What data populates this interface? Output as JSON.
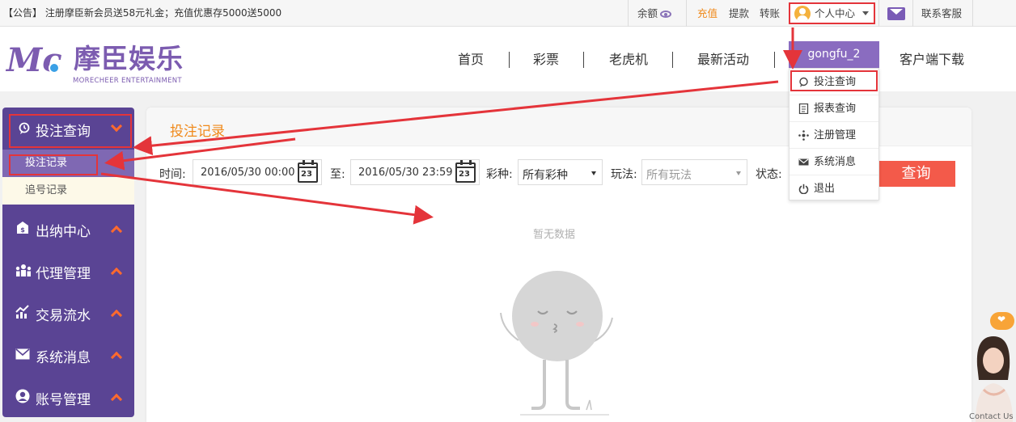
{
  "topbar": {
    "notice": "【公告】 注册摩臣新会员送58元礼金；充值优惠存5000送5000",
    "balance_label": "余额",
    "recharge": "充值",
    "withdraw": "提款",
    "transfer": "转账",
    "personal_center": "个人中心",
    "customer_service": "联系客服"
  },
  "header": {
    "logo_mark": "Mc",
    "logo_cn": "摩臣娱乐",
    "logo_en": "MORECHEER ENTERTAINMENT",
    "nav": [
      "首页",
      "彩票",
      "老虎机",
      "最新活动",
      "客户端下载"
    ]
  },
  "dropdown": {
    "username": "gongfu_2",
    "items": [
      {
        "label": "投注查询",
        "icon": "bet-query-icon"
      },
      {
        "label": "报表查询",
        "icon": "report-icon"
      },
      {
        "label": "注册管理",
        "icon": "register-icon"
      },
      {
        "label": "系统消息",
        "icon": "mail-icon"
      },
      {
        "label": "退出",
        "icon": "power-icon"
      }
    ]
  },
  "sidebar": {
    "header": "投注查询",
    "sub_items": [
      "投注记录",
      "追号记录"
    ],
    "items": [
      {
        "label": "出纳中心",
        "icon": "wallet-icon"
      },
      {
        "label": "代理管理",
        "icon": "agent-icon"
      },
      {
        "label": "交易流水",
        "icon": "chart-icon"
      },
      {
        "label": "系统消息",
        "icon": "mail-icon"
      },
      {
        "label": "账号管理",
        "icon": "user-icon"
      }
    ]
  },
  "content": {
    "title": "投注记录",
    "filters": {
      "time_label": "时间:",
      "start": "2016/05/30 00:00",
      "to_label": "至:",
      "end": "2016/05/30 23:59",
      "calendar_day": "23",
      "lottery_label": "彩种:",
      "lottery_value": "所有彩种",
      "play_label": "玩法:",
      "play_value": "所有玩法",
      "status_label": "状态:"
    },
    "query_button": "查询",
    "empty_text": "暂无数据"
  },
  "float": {
    "contact_label": "Contact Us"
  },
  "colors": {
    "brand_purple": "#5a4494",
    "accent_orange": "#f08a1c",
    "query_red": "#f35a4a",
    "highlight_red": "#e4343a"
  }
}
